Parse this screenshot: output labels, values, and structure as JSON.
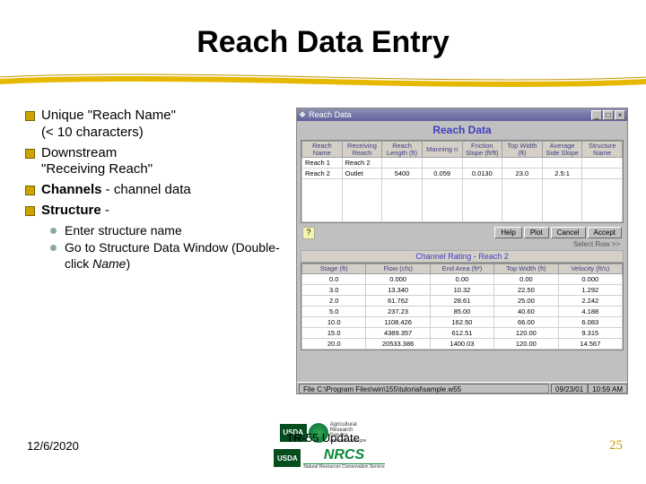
{
  "title": "Reach Data Entry",
  "bullets": [
    {
      "main": "Unique \"Reach Name\"",
      "cont": "(< 10 characters)"
    },
    {
      "main": "Downstream",
      "cont": "\"Receiving Reach\""
    },
    {
      "main_html": "<b>Channels</b> - channel data"
    },
    {
      "main_html": "<b>Structure</b> -"
    }
  ],
  "sub_bullets": [
    "Enter structure name",
    "Go to Structure Data Window (Double-click <span class='italic'>Name</span>)"
  ],
  "win": {
    "title": "Reach Data",
    "panel_title": "Reach Data",
    "reach_headers": [
      "Reach Name",
      "Receiving Reach",
      "Reach Length (ft)",
      "Manning n",
      "Friction Slope (ft/ft)",
      "Top Width (ft)",
      "Average Side Slope",
      "Structure Name"
    ],
    "reach_rows": [
      [
        "Reach 1",
        "Reach 2",
        "",
        "",
        "",
        "",
        "",
        ""
      ],
      [
        "Reach 2",
        "Outlet",
        "5400",
        "0.059",
        "0.0130",
        "23.0",
        "2.5:1",
        ""
      ]
    ],
    "buttons": [
      "Help",
      "Plot",
      "Cancel",
      "Accept"
    ],
    "action_hint": "Select Row >>",
    "rating_title": "Channel Rating - Reach 2",
    "rating_headers": [
      "Stage (ft)",
      "Flow (cfs)",
      "End Area (ft²)",
      "Top Width (ft)",
      "Velocity (ft/s)"
    ],
    "rating_rows": [
      [
        "0.0",
        "0.000",
        "0.00",
        "0.00",
        "0.000"
      ],
      [
        "3.0",
        "13.340",
        "10.32",
        "22.50",
        "1.292"
      ],
      [
        "2.0",
        "61.762",
        "28.61",
        "25.00",
        "2.242"
      ],
      [
        "5.0",
        "237.23",
        "85.00",
        "40.60",
        "4.188"
      ],
      [
        "10.0",
        "1108.426",
        "162.50",
        "66.00",
        "6.083"
      ],
      [
        "15.0",
        "4389.357",
        "612.51",
        "120.00",
        "9.315"
      ],
      [
        "20.0",
        "20533.386",
        "1400.03",
        "120.00",
        "14.567"
      ]
    ],
    "status_path": "File C:\\Program Files\\win\\155\\tutorial\\sample.w55",
    "status_date": "09/23/01",
    "status_time": "10:59 AM"
  },
  "footer": {
    "date": "12/6/2020",
    "center": "TR-55 Update",
    "page": "25",
    "logos": {
      "usda": "USDA",
      "ars_lines": [
        "Agricultural",
        "Research",
        "Service"
      ],
      "ars_url": "www.ars.usda.gov",
      "nrcs": "NRCS",
      "nrcs_sub": "Natural Resources Conservation Service"
    }
  }
}
